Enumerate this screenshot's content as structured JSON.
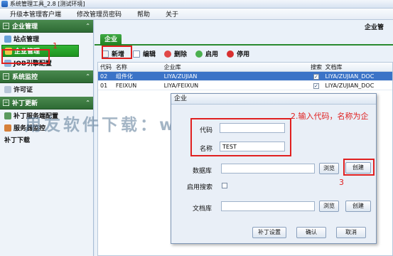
{
  "window": {
    "title": "系统管理工具_2.8 [测试环境]"
  },
  "menu": [
    "升级本管理客户端",
    "修改管理员密码",
    "帮助",
    "关于"
  ],
  "sidebar": {
    "groups": [
      {
        "label": "企业管理",
        "items": [
          {
            "label": "站点管理"
          },
          {
            "label": "企业管理",
            "selected": true
          },
          {
            "label": "JOB引擎配置"
          }
        ]
      },
      {
        "label": "系统监控",
        "items": [
          {
            "label": "许可证"
          }
        ]
      },
      {
        "label": "补丁更新",
        "items": [
          {
            "label": "补丁服务端配置"
          },
          {
            "label": "服务器监控"
          },
          {
            "label": "补丁下载"
          }
        ]
      }
    ]
  },
  "main": {
    "breadcrumb": "企业管",
    "tab": "企业",
    "toolbar": [
      "新增",
      "编辑",
      "删除",
      "启用",
      "停用"
    ],
    "columns": [
      "代码",
      "名称",
      "企业库",
      "搜索",
      "文档库"
    ],
    "rows": [
      {
        "code": "02",
        "name": "组件化",
        "db": "LIYA/ZUJIAN",
        "search": "✓",
        "doc": "LIYA/ZUJIAN_DOC"
      },
      {
        "code": "01",
        "name": "FEIXUN",
        "db": "LIYA/FEIXUN",
        "search": "✓",
        "doc": "LIYA/ZUJIAN_DOC"
      }
    ]
  },
  "dialog": {
    "title": "企业",
    "code_label": "代码",
    "code_value": "",
    "name_label": "名称",
    "name_value": "TEST",
    "db_label": "数据库",
    "search_label": "启用搜索",
    "doc_label": "文档库",
    "browse_label": "浏览",
    "create_label": "创建",
    "patch_label": "补丁设置",
    "ok_label": "确认",
    "cancel_label": "取消"
  },
  "annotations": {
    "n1": "1",
    "n3": "3",
    "hint": "2.输入代码，名称为企"
  },
  "watermark": "用友软件下载：www.rfdawhy.com",
  "colors": {
    "sidebar_group": "#2e6b34",
    "selected": "#1e931f",
    "row_selected": "#3b73c7",
    "annotation": "#e02020"
  }
}
